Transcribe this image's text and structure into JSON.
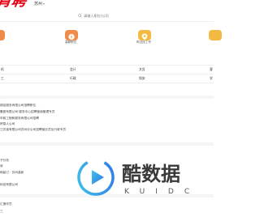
{
  "header": {
    "logo_text": "肯聘",
    "city": "苏州",
    "city_caret": "▾",
    "search_placeholder": "请输入职位/公司"
  },
  "shortcuts": [
    {
      "label": ""
    },
    {
      "label": "高薪职位"
    },
    {
      "label": "附近找工作"
    },
    {
      "label": ""
    }
  ],
  "categories": {
    "row1": [
      "机",
      "会计",
      "文员",
      "客"
    ],
    "row2": [
      "工",
      "行政",
      "保安",
      "学"
    ]
  },
  "companies": [
    "锦佳服务有限公司招聘职位",
    "集团有限公司·服务中心招聘营销管理专员",
    "市政工程和服务有限公司招聘",
    "贸易人公司",
    "江苏省有限公司苏州分公司招聘营业员及行政专员"
  ],
  "positions": [
    "子分析",
    "收",
    "和装订 · 苏州高新",
    "",
    "科技有限公司"
  ],
  "recent": [
    "汇操作员",
    "三"
  ],
  "watermark": {
    "title": "酷数据",
    "subtitle": "KUIDC"
  },
  "colors": {
    "brand": "#e60012",
    "tile_orange": "#f08c49",
    "tile_yellow": "#f4b942",
    "watermark_blue": "#2f78e6",
    "watermark_cyan": "#3fc3e8"
  }
}
